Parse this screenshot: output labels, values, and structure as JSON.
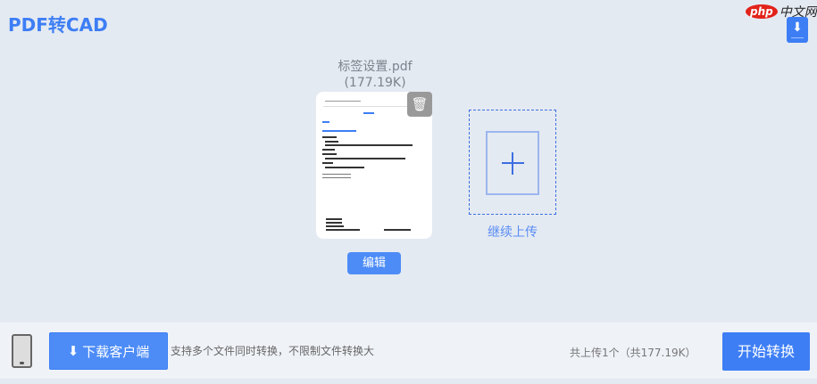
{
  "header": {
    "title": "PDF转CAD",
    "logo_php": "php",
    "logo_cn": "中文网"
  },
  "file": {
    "name": "标签设置.pdf",
    "size": "(177.19K)",
    "edit_label": "编辑"
  },
  "upload": {
    "label": "继续上传"
  },
  "footer": {
    "download_label": "下载客户端",
    "tip": "支持多个文件同时转换，不限制文件转换大",
    "count": "共上传1个（共177.19K）",
    "start_label": "开始转换"
  },
  "colors": {
    "accent": "#3d7ef5"
  }
}
